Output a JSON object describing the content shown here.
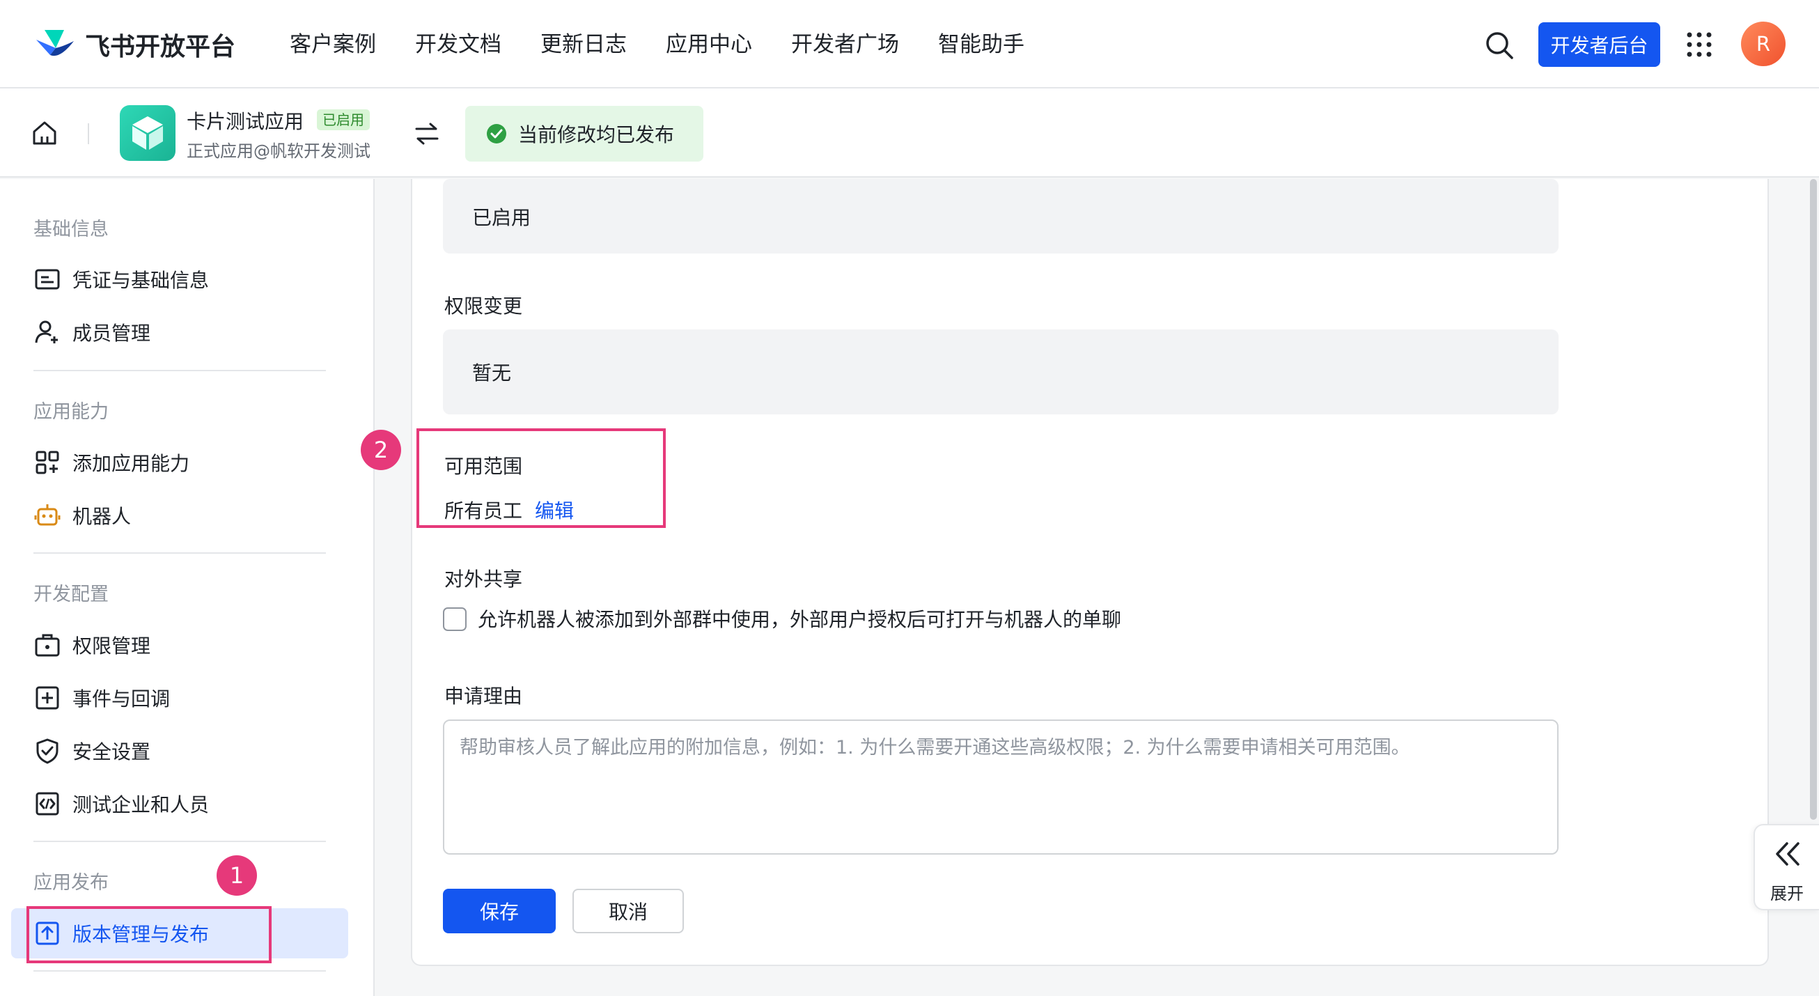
{
  "topnav": {
    "brand": "飞书开放平台",
    "links": [
      "客户案例",
      "开发文档",
      "更新日志",
      "应用中心",
      "开发者广场",
      "智能助手"
    ],
    "console_label": "开发者后台",
    "avatar_initial": "R"
  },
  "app": {
    "name": "卡片测试应用",
    "badge": "已启用",
    "subtitle": "正式应用@帆软开发测试",
    "publish_status": "当前修改均已发布"
  },
  "sidebar": {
    "groups": {
      "basic": "基础信息",
      "capability": "应用能力",
      "dev": "开发配置",
      "release": "应用发布"
    },
    "items": {
      "credentials": "凭证与基础信息",
      "members": "成员管理",
      "add_capability": "添加应用能力",
      "bot": "机器人",
      "permissions": "权限管理",
      "events": "事件与回调",
      "security": "安全设置",
      "test_org": "测试企业和人员",
      "version": "版本管理与发布"
    }
  },
  "form": {
    "status_value": "已启用",
    "permission_change_label": "权限变更",
    "permission_change_value": "暂无",
    "scope_label": "可用范围",
    "scope_value": "所有员工",
    "scope_edit": "编辑",
    "sharing_label": "对外共享",
    "sharing_checkbox_label": "允许机器人被添加到外部群中使用，外部用户授权后可打开与机器人的单聊",
    "sharing_checked": false,
    "reason_label": "申请理由",
    "reason_placeholder": "帮助审核人员了解此应用的附加信息，例如：1. 为什么需要开通这些高级权限；2. 为什么需要申请相关可用范围。",
    "reason_value": "",
    "save_label": "保存",
    "cancel_label": "取消"
  },
  "annotations": {
    "step1": "1",
    "step2": "2"
  },
  "expand_label": "展开",
  "colors": {
    "accent": "#1456f0",
    "annotation": "#e6397a",
    "success": "#2ea043"
  }
}
